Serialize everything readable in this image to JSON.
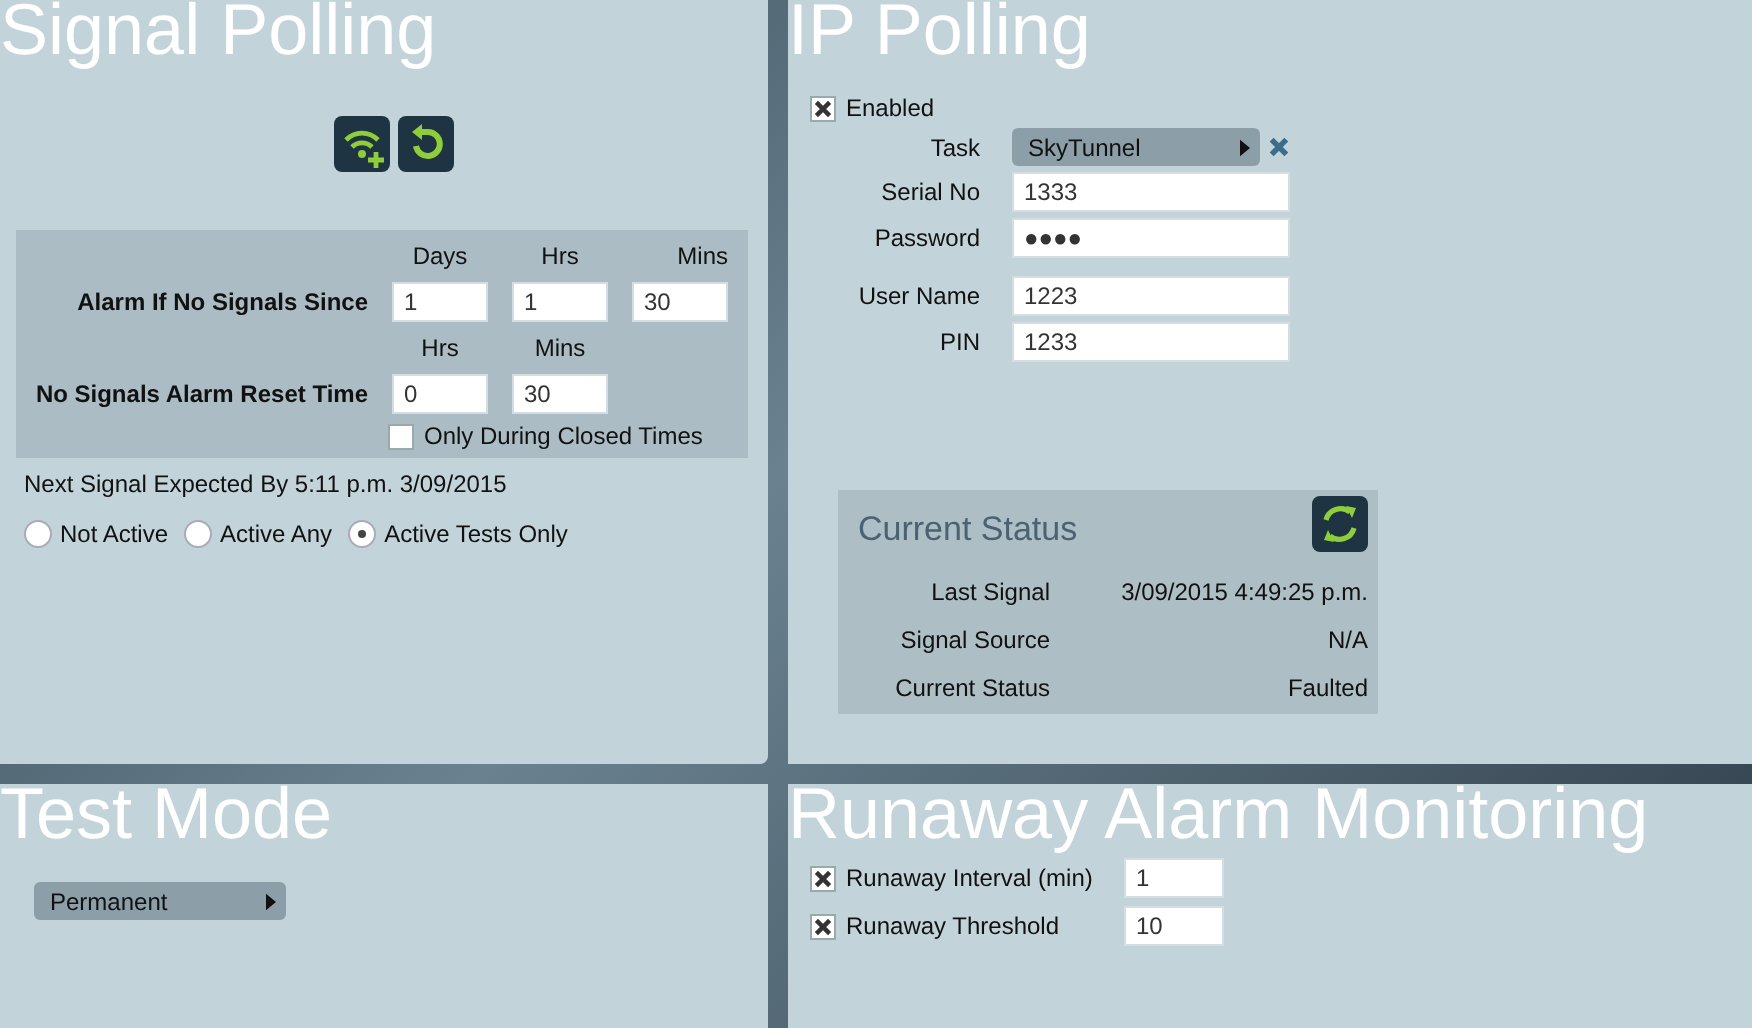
{
  "signal_polling": {
    "title": "Signal Polling",
    "alarm_box": {
      "headers_1": [
        "Days",
        "Hrs",
        "Mins"
      ],
      "alarm_label": "Alarm If No Signals Since",
      "alarm_values": [
        "1",
        "1",
        "30"
      ],
      "headers_2": [
        "Hrs",
        "Mins"
      ],
      "reset_label": "No Signals Alarm Reset Time",
      "reset_values": [
        "0",
        "30"
      ],
      "closed_times": {
        "label": "Only During Closed Times",
        "checked": false
      }
    },
    "next_signal": "Next Signal Expected By 5:11 p.m. 3/09/2015",
    "modes": [
      {
        "label": "Not Active",
        "selected": false
      },
      {
        "label": "Active Any",
        "selected": false
      },
      {
        "label": "Active Tests Only",
        "selected": true
      }
    ]
  },
  "ip_polling": {
    "title": "IP Polling",
    "enabled": {
      "label": "Enabled",
      "checked": true
    },
    "task": {
      "label": "Task",
      "value": "SkyTunnel"
    },
    "login_fields": [
      {
        "label": "Serial No",
        "value": "1333"
      },
      {
        "label": "Password",
        "value": "●●●●"
      }
    ],
    "user_fields": [
      {
        "label": "User Name",
        "value": "1223"
      },
      {
        "label": "PIN",
        "value": "1233"
      }
    ],
    "current_status": {
      "title": "Current Status",
      "rows": [
        {
          "label": "Last Signal",
          "value": "3/09/2015 4:49:25 p.m."
        },
        {
          "label": "Signal Source",
          "value": "N/A"
        },
        {
          "label": "Current Status",
          "value": "Faulted"
        }
      ]
    }
  },
  "test_mode": {
    "title": "Test Mode",
    "mode": "Permanent"
  },
  "runaway": {
    "title": "Runaway Alarm Monitoring",
    "rows": [
      {
        "label": "Runaway Interval (min)",
        "checked": true,
        "value": "1"
      },
      {
        "label": "Runaway Threshold",
        "checked": true,
        "value": "10"
      }
    ]
  }
}
